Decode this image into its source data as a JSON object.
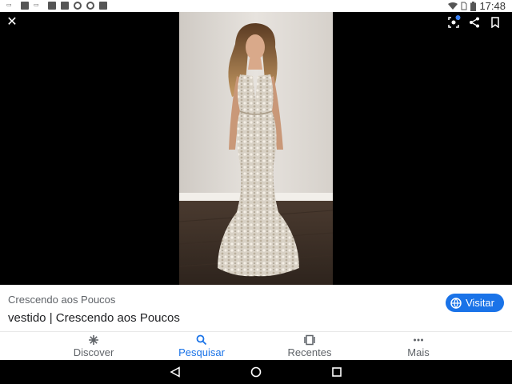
{
  "status_bar": {
    "time": "17:48",
    "left_icons": [
      "cast-icon",
      "image-icon",
      "cast-icon",
      "image-icon",
      "image-icon",
      "chrome-icon",
      "chrome-icon",
      "gallery-icon"
    ],
    "right_icons": [
      "wifi-icon",
      "no-sim-icon",
      "battery-icon"
    ]
  },
  "viewer": {
    "close_icon": "close-icon",
    "actions": [
      "lens-icon",
      "share-icon",
      "bookmark-icon"
    ],
    "accent": "#3b82f6"
  },
  "result": {
    "source": "Crescendo aos Poucos",
    "title": "vestido | Crescendo aos Poucos",
    "visit_label": "Visitar",
    "visit_color": "#1a73e8"
  },
  "bottom_nav": {
    "items": [
      {
        "label": "Discover",
        "icon": "asterisk-icon",
        "active": false
      },
      {
        "label": "Pesquisar",
        "icon": "search-icon",
        "active": true
      },
      {
        "label": "Recentes",
        "icon": "recent-tabs-icon",
        "active": false
      },
      {
        "label": "Mais",
        "icon": "more-dots-icon",
        "active": false
      }
    ]
  },
  "system_nav": [
    "back-icon",
    "home-icon",
    "overview-icon"
  ]
}
